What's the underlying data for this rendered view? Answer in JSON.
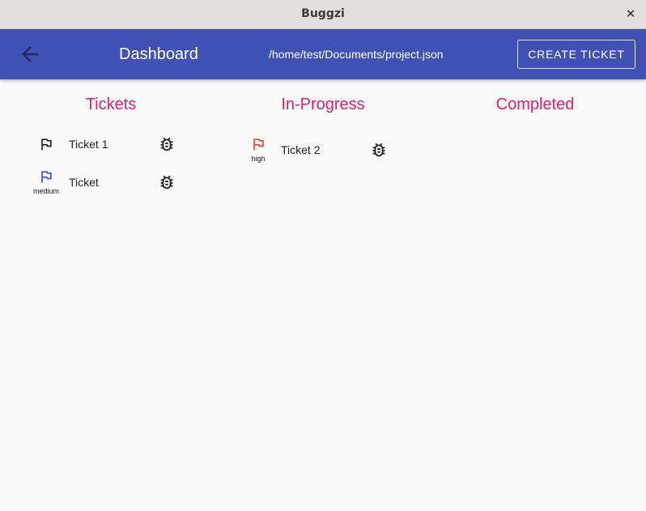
{
  "window": {
    "title": "Buggzi",
    "close_glyph": "✕"
  },
  "appbar": {
    "back_icon": "arrow-back-icon",
    "title": "Dashboard",
    "path": "/home/test/Documents/project.json",
    "create_label": "CREATE TICKET",
    "color": "#3f51b5"
  },
  "colors": {
    "heading": "#e91e63",
    "flag_default": "#222222",
    "flag_medium": "#3f51b5",
    "flag_high": "#f44336"
  },
  "columns": [
    {
      "title": "Tickets",
      "tickets": [
        {
          "name": "Ticket 1",
          "priority": "",
          "flag_color": "#222222",
          "icon": "bug-icon"
        },
        {
          "name": "Ticket",
          "priority": "medium",
          "flag_color": "#3f51b5",
          "icon": "bug-icon"
        }
      ]
    },
    {
      "title": "In-Progress",
      "tickets": [
        {
          "name": "Ticket 2",
          "priority": "high",
          "flag_color": "#f44336",
          "icon": "bug-icon"
        }
      ]
    },
    {
      "title": "Completed",
      "tickets": []
    }
  ]
}
